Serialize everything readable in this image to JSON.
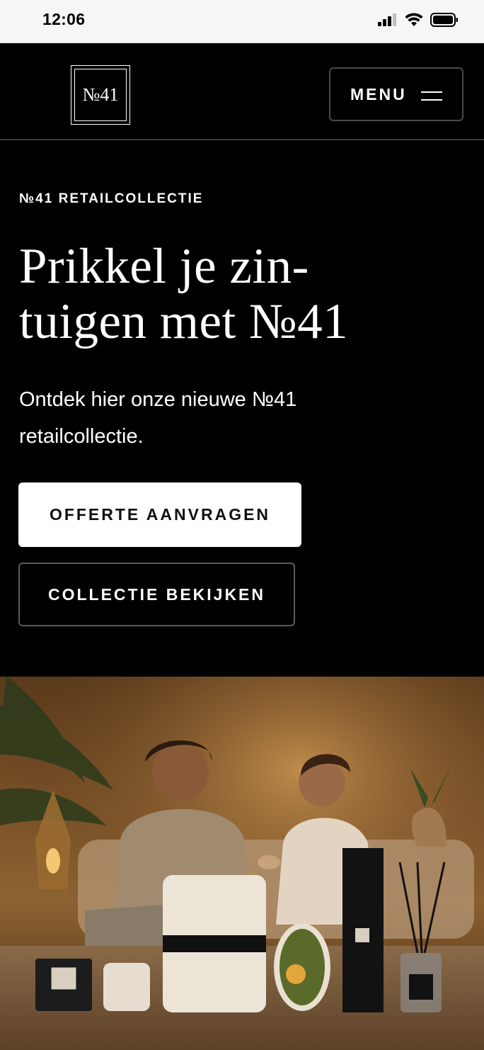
{
  "status_bar": {
    "time": "12:06"
  },
  "header": {
    "logo_text": "№41",
    "menu_label": "MENU"
  },
  "hero": {
    "eyebrow": "№41 RETAILCOLLECTIE",
    "title_line1": "Prikkel je zin-",
    "title_line2": "tuigen met №41",
    "subtitle": "Ontdek hier onze nieuwe №41 retailcollectie.",
    "primary_cta": "OFFERTE AANVRAGEN",
    "secondary_cta": "COLLECTIE BEKIJKEN"
  },
  "colors": {
    "background": "#000000",
    "text": "#ffffff",
    "button_primary_bg": "#ffffff",
    "button_primary_text": "#111111",
    "status_bar_bg": "#f6f6f6"
  },
  "icons": [
    "signal-icon",
    "wifi-icon",
    "battery-icon",
    "menu-icon"
  ]
}
